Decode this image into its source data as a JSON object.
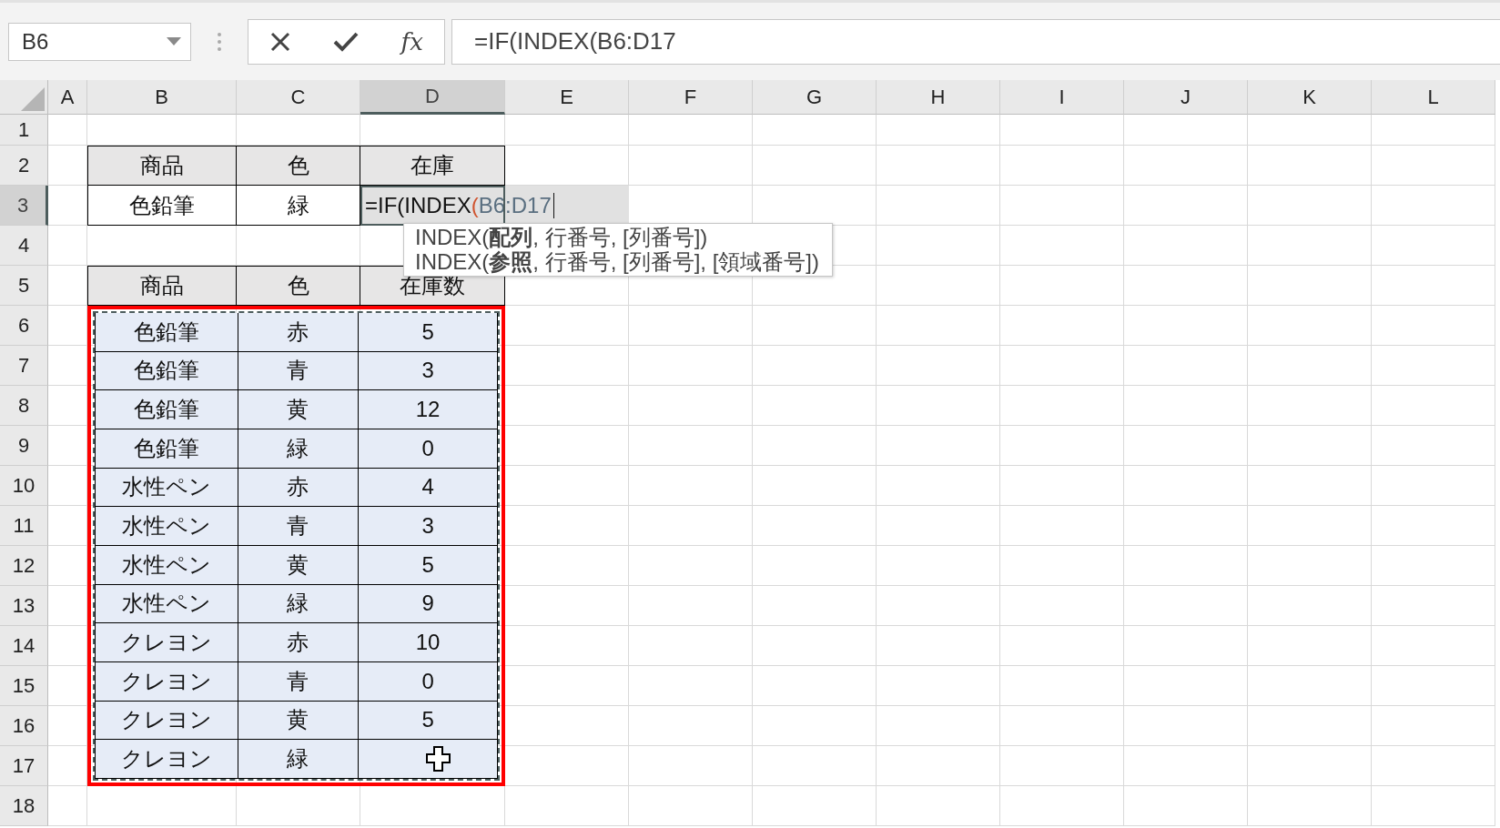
{
  "formula_bar": {
    "name_box": "B6",
    "function_button": "fx",
    "formula": "=IF(INDEX(B6:D17"
  },
  "column_headers": [
    {
      "label": "A",
      "selected": false
    },
    {
      "label": "B",
      "selected": false
    },
    {
      "label": "C",
      "selected": false
    },
    {
      "label": "D",
      "selected": true
    },
    {
      "label": "E",
      "selected": false
    },
    {
      "label": "F",
      "selected": false
    },
    {
      "label": "G",
      "selected": false
    },
    {
      "label": "H",
      "selected": false
    },
    {
      "label": "I",
      "selected": false
    },
    {
      "label": "J",
      "selected": false
    },
    {
      "label": "K",
      "selected": false
    },
    {
      "label": "L",
      "selected": false
    }
  ],
  "row_headers": [
    {
      "label": "1",
      "selected": false
    },
    {
      "label": "2",
      "selected": false
    },
    {
      "label": "3",
      "selected": true
    },
    {
      "label": "4",
      "selected": false
    },
    {
      "label": "5",
      "selected": false
    },
    {
      "label": "6",
      "selected": false
    },
    {
      "label": "7",
      "selected": false
    },
    {
      "label": "8",
      "selected": false
    },
    {
      "label": "9",
      "selected": false
    },
    {
      "label": "10",
      "selected": false
    },
    {
      "label": "11",
      "selected": false
    },
    {
      "label": "12",
      "selected": false
    },
    {
      "label": "13",
      "selected": false
    },
    {
      "label": "14",
      "selected": false
    },
    {
      "label": "15",
      "selected": false
    },
    {
      "label": "16",
      "selected": false
    },
    {
      "label": "17",
      "selected": false
    },
    {
      "label": "18",
      "selected": false
    }
  ],
  "lookup_table": {
    "headers": [
      "商品",
      "色",
      "在庫"
    ],
    "values": [
      "色鉛筆",
      "緑"
    ]
  },
  "edit_cell": {
    "parts": [
      {
        "text": "=IF(INDEX",
        "kind": "plain"
      },
      {
        "text": "(",
        "kind": "paren"
      },
      {
        "text": "B6:D17",
        "kind": "ref"
      }
    ]
  },
  "tooltip": {
    "lines": [
      "INDEX(**配列**, 行番号, [列番号])",
      "INDEX(**参照**, 行番号, [列番号], [領域番号])"
    ]
  },
  "data_table": {
    "selected": true,
    "outlined": true,
    "headers": [
      "商品",
      "色",
      "在庫数"
    ],
    "rows": [
      [
        "色鉛筆",
        "赤",
        "5"
      ],
      [
        "色鉛筆",
        "青",
        "3"
      ],
      [
        "色鉛筆",
        "黄",
        "12"
      ],
      [
        "色鉛筆",
        "緑",
        "0"
      ],
      [
        "水性ペン",
        "赤",
        "4"
      ],
      [
        "水性ペン",
        "青",
        "3"
      ],
      [
        "水性ペン",
        "黄",
        "5"
      ],
      [
        "水性ペン",
        "緑",
        "9"
      ],
      [
        "クレヨン",
        "赤",
        "10"
      ],
      [
        "クレヨン",
        "青",
        "0"
      ],
      [
        "クレヨン",
        "黄",
        "5"
      ],
      [
        "クレヨン",
        "緑"
      ]
    ]
  }
}
